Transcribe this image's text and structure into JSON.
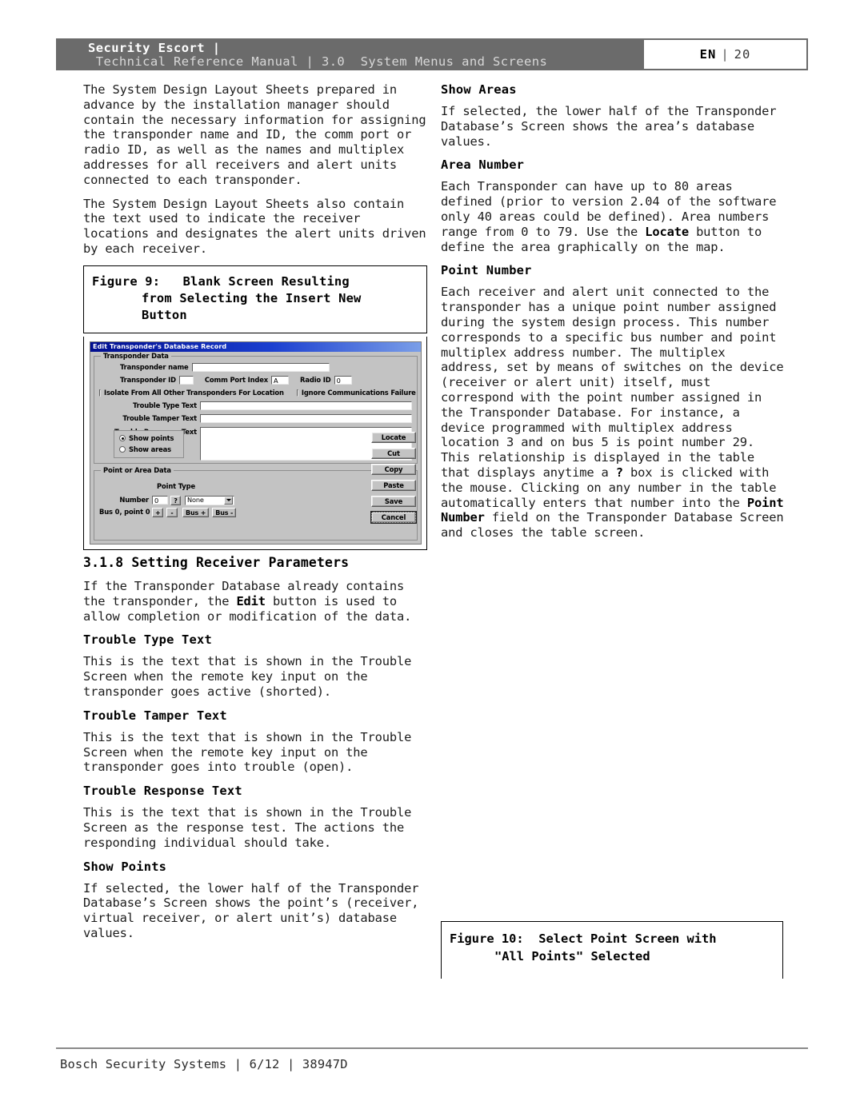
{
  "header": {
    "brand": "Security Escort |",
    "rest": " Technical Reference Manual | 3.0  System Menus and Screens",
    "lang": "EN",
    "separator": "|",
    "page_number": "20"
  },
  "left_column": {
    "para_1": "The System Design Layout Sheets prepared in advance by the installation manager should contain the necessary information for assigning the transponder name and ID, the comm port or radio ID, as well as the names and multiplex addresses for all receivers and alert units connected to each transponder.",
    "para_2": "The System Design Layout Sheets also contain the text used to indicate the receiver locations and designates the alert units driven by each receiver.",
    "figure_9": {
      "line_1": "Figure 9:   Blank Screen Resulting",
      "line_2": "from Selecting the Insert New",
      "line_3": "Button"
    },
    "section": {
      "heading": "3.1.8 Setting Receiver Parameters",
      "para": {
        "a": "If the Transponder Database already contains the transponder, the ",
        "bold": "Edit",
        "b": " button is used to allow completion or modification of the data."
      }
    },
    "subsections": [
      {
        "heading": "Trouble Type Text",
        "body": "This is the text that is shown in the Trouble Screen when the remote key input on the transponder goes active (shorted)."
      },
      {
        "heading": "Trouble Tamper Text",
        "body": "This is the text that is shown in the Trouble Screen when the remote key input on the transponder goes into trouble (open)."
      },
      {
        "heading": "Trouble Response Text",
        "body": "This is the text that is shown in the Trouble Screen as the response test. The actions the responding individual should take."
      },
      {
        "heading": "Show Points",
        "body": "If selected, the lower half of the Transponder Database’s Screen shows the point’s (receiver, virtual receiver, or alert unit’s) database values."
      }
    ]
  },
  "right_column": {
    "subsections": [
      {
        "heading": "Show Areas",
        "body": "If selected, the lower half of the Transponder Database’s Screen shows the area’s database values."
      }
    ],
    "area_number": {
      "heading": "Area Number",
      "a": "Each Transponder can have up to 80 areas defined (prior to version 2.04 of the software only 40 areas could be defined). Area numbers range from 0 to 79. Use the ",
      "bold": "Locate",
      "b": " button to define the area graphically on the map."
    },
    "point_number": {
      "heading": "Point Number",
      "a": "Each receiver and alert unit connected to the transponder has a unique point number assigned during the system design process. This number corresponds to a specific bus number and point multiplex address number. The multiplex address, set by means of switches on the device (receiver or alert unit) itself, must correspond with the point number assigned in the Transponder Database. For instance, a device programmed with multiplex address location 3 and on bus 5 is point number 29. This relationship is displayed in the table that displays anytime a ",
      "bold_1": "?",
      "b": " box is clicked with the mouse. Clicking on any number in the table automatically enters that number into the ",
      "bold_2": "Point Number",
      "c": " field on the Transponder Database Screen and closes the table screen."
    },
    "figure_10": {
      "line_1": "Figure 10:  Select Point Screen with",
      "line_2": "\"All Points\" Selected"
    }
  },
  "screenshot": {
    "title": "Edit Transponder's Database Record",
    "group_transponder": {
      "legend": "Transponder Data",
      "transponder_name_label": "Transponder name",
      "transponder_name_value": "",
      "transponder_id_label": "Transponder ID",
      "transponder_id_value": "",
      "comm_port_label": "Comm Port Index",
      "comm_port_value": "A",
      "radio_id_label": "Radio ID",
      "radio_id_value": "0",
      "isolate_label": "Isolate From All Other Transponders For Location",
      "ignore_label": "Ignore Communications Failure",
      "trouble_type_label": "Trouble Type Text",
      "trouble_type_value": "",
      "trouble_tamper_label": "Trouble Tamper Text",
      "trouble_tamper_value": "",
      "trouble_response_label": "Trouble Response Text",
      "trouble_response_value": "",
      "radio_show_points": "Show points",
      "radio_show_areas": "Show areas"
    },
    "group_point": {
      "legend": "Point or Area Data",
      "point_type_label": "Point Type",
      "number_label": "Number",
      "number_value": "0",
      "help_label": "?",
      "point_type_value": "None",
      "bus_point_label": "Bus 0, point 0",
      "plus_label": "+",
      "minus_label": "-",
      "bus_plus_label": "Bus +",
      "bus_minus_label": "Bus -"
    },
    "buttons": [
      "Locate",
      "Cut",
      "Copy",
      "Paste",
      "Save",
      "Cancel"
    ]
  },
  "footer": {
    "text": "Bosch Security Systems | 6/12 | 38947D"
  }
}
